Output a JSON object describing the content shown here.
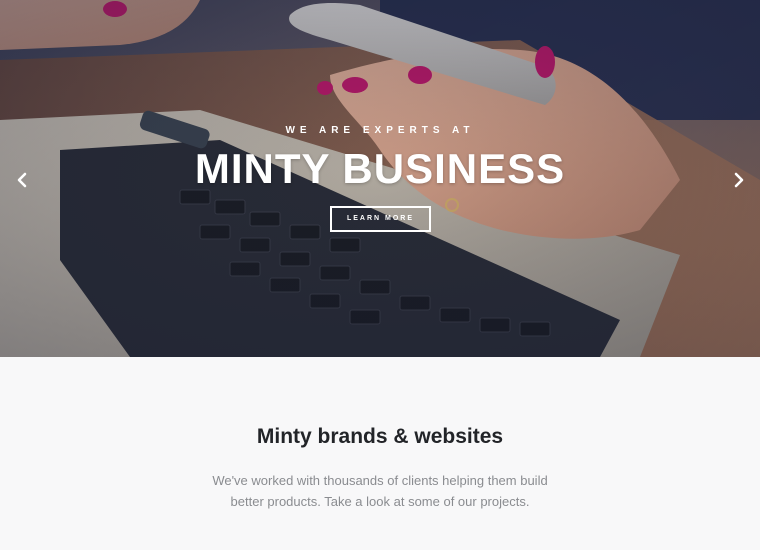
{
  "hero": {
    "eyebrow": "WE ARE EXPERTS AT",
    "title": "MINTY BUSINESS",
    "cta_label": "LEARN MORE",
    "prev_icon": "chevron-left-icon",
    "next_icon": "chevron-right-icon"
  },
  "intro": {
    "title": "Minty brands & websites",
    "text": "We've worked with thousands of clients helping them build better products. Take a look at some of our projects."
  },
  "colors": {
    "hero_overlay": "#1b2540",
    "section_bg": "#f8f8f9",
    "title_text": "#222428",
    "body_text": "#8a8c90",
    "accent_nail": "#c2186b"
  }
}
